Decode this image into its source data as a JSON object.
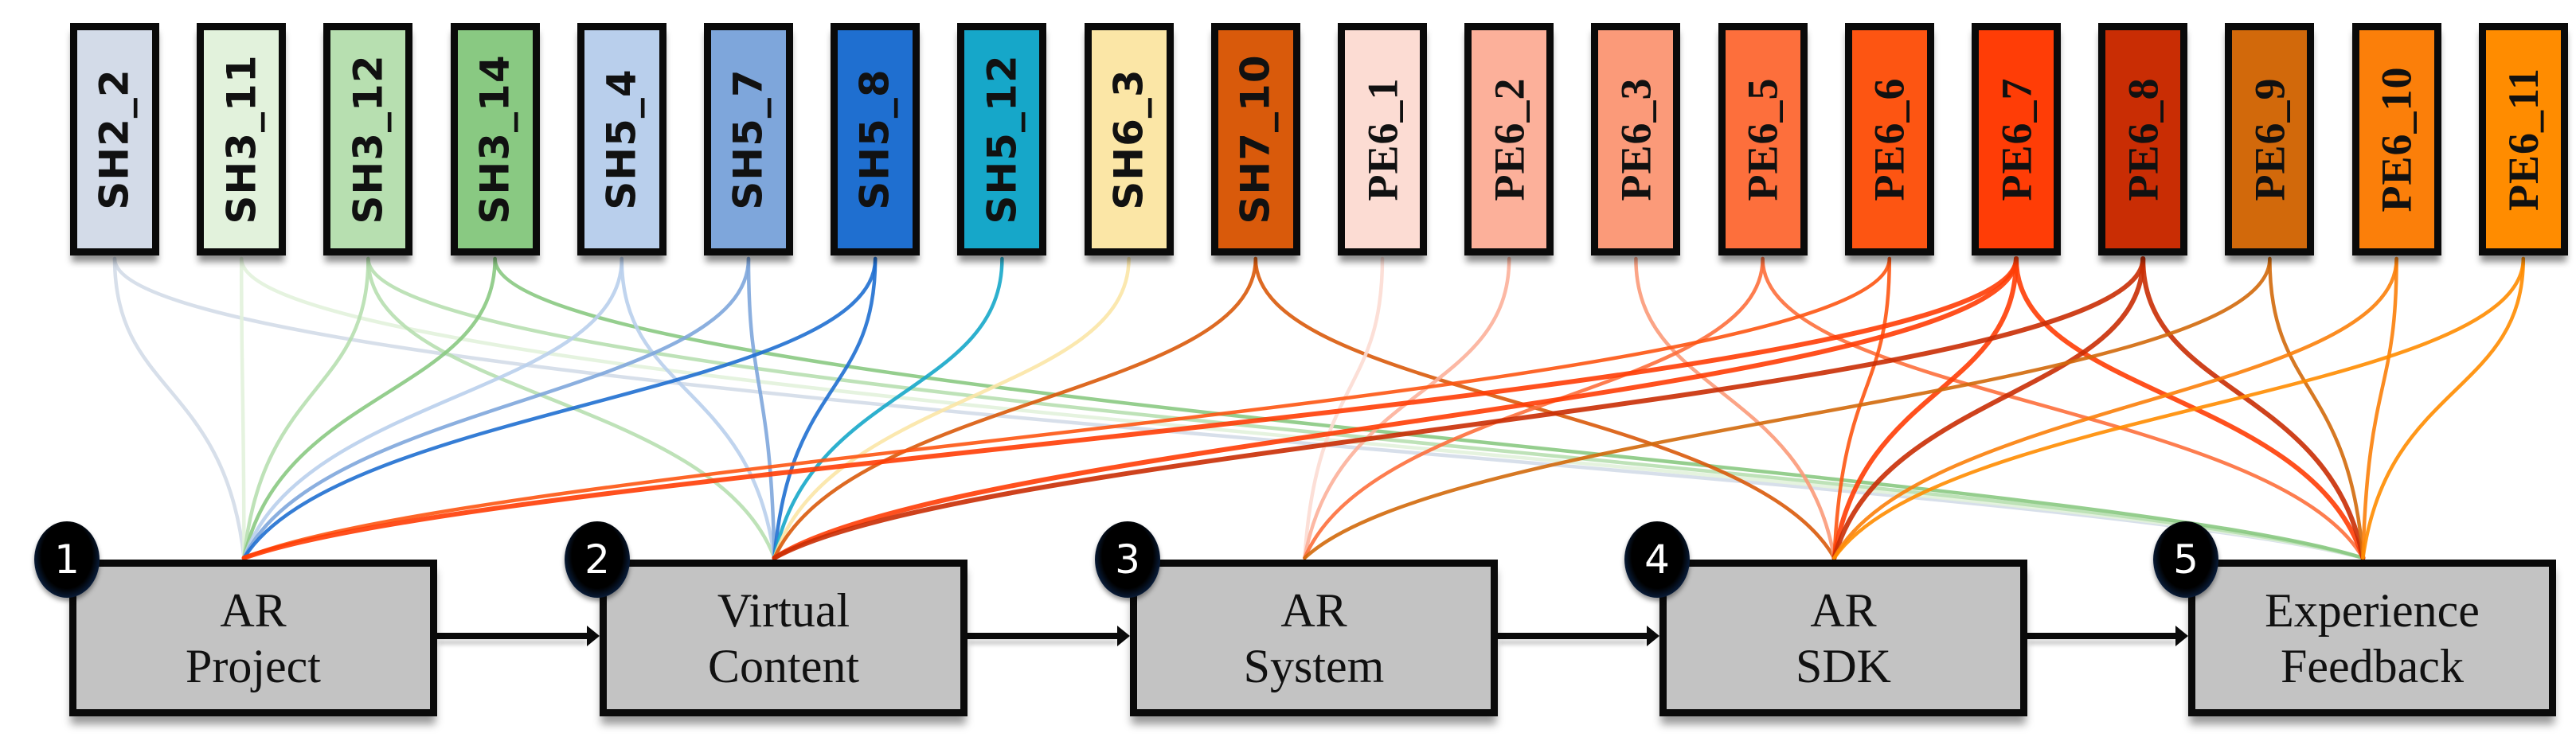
{
  "diagram": {
    "type": "bipartite-flow",
    "tags": [
      {
        "id": "SH2_2",
        "label": "SH2_2",
        "color": "#d3dbe8",
        "group": "SH"
      },
      {
        "id": "SH3_11",
        "label": "SH3_11",
        "color": "#e2f2dc",
        "group": "SH"
      },
      {
        "id": "SH3_12",
        "label": "SH3_12",
        "color": "#b7dfb0",
        "group": "SH"
      },
      {
        "id": "SH3_14",
        "label": "SH3_14",
        "color": "#89c982",
        "group": "SH"
      },
      {
        "id": "SH5_4",
        "label": "SH5_4",
        "color": "#b9cfec",
        "group": "SH"
      },
      {
        "id": "SH5_7",
        "label": "SH5_7",
        "color": "#7ea6db",
        "group": "SH"
      },
      {
        "id": "SH5_8",
        "label": "SH5_8",
        "color": "#1f6fd0",
        "group": "SH"
      },
      {
        "id": "SH5_12",
        "label": "SH5_12",
        "color": "#16a7c9",
        "group": "SH"
      },
      {
        "id": "SH6_3",
        "label": "SH6_3",
        "color": "#fbe6a6",
        "group": "SH"
      },
      {
        "id": "SH7_10",
        "label": "SH7_10",
        "color": "#d95a0b",
        "group": "SH"
      },
      {
        "id": "PE6_1",
        "label": "PE6_1",
        "color": "#fcdcd3",
        "group": "PE"
      },
      {
        "id": "PE6_2",
        "label": "PE6_2",
        "color": "#fcb09a",
        "group": "PE"
      },
      {
        "id": "PE6_3",
        "label": "PE6_3",
        "color": "#fb9a79",
        "group": "PE"
      },
      {
        "id": "PE6_5",
        "label": "PE6_5",
        "color": "#fd6f3c",
        "group": "PE"
      },
      {
        "id": "PE6_6",
        "label": "PE6_6",
        "color": "#fd5512",
        "group": "PE"
      },
      {
        "id": "PE6_7",
        "label": "PE6_7",
        "color": "#ff3d06",
        "group": "PE"
      },
      {
        "id": "PE6_8",
        "label": "PE6_8",
        "color": "#c92d04",
        "group": "PE"
      },
      {
        "id": "PE6_9",
        "label": "PE6_9",
        "color": "#d2690b",
        "group": "PE"
      },
      {
        "id": "PE6_10",
        "label": "PE6_10",
        "color": "#fb7f0a",
        "group": "PE"
      },
      {
        "id": "PE6_11",
        "label": "PE6_11",
        "color": "#ff8c00",
        "group": "PE"
      }
    ],
    "steps": [
      {
        "number": "1",
        "lines": [
          "AR",
          "Project"
        ]
      },
      {
        "number": "2",
        "lines": [
          "Virtual",
          "Content"
        ]
      },
      {
        "number": "3",
        "lines": [
          "AR",
          "System"
        ]
      },
      {
        "number": "4",
        "lines": [
          "AR",
          "SDK"
        ]
      },
      {
        "number": "5",
        "lines": [
          "Experience",
          "Feedback"
        ]
      }
    ],
    "links": [
      [
        "SH2_2",
        1
      ],
      [
        "SH2_2",
        5
      ],
      [
        "SH3_11",
        1
      ],
      [
        "SH3_11",
        5
      ],
      [
        "SH3_12",
        1
      ],
      [
        "SH3_12",
        2
      ],
      [
        "SH3_12",
        5
      ],
      [
        "SH3_14",
        1
      ],
      [
        "SH3_14",
        5
      ],
      [
        "SH5_4",
        1
      ],
      [
        "SH5_4",
        2
      ],
      [
        "SH5_7",
        1
      ],
      [
        "SH5_7",
        2
      ],
      [
        "SH5_8",
        1
      ],
      [
        "SH5_8",
        2
      ],
      [
        "SH5_12",
        2
      ],
      [
        "SH6_3",
        2
      ],
      [
        "SH7_10",
        2
      ],
      [
        "SH7_10",
        4
      ],
      [
        "PE6_1",
        3
      ],
      [
        "PE6_2",
        3
      ],
      [
        "PE6_3",
        4
      ],
      [
        "PE6_5",
        3
      ],
      [
        "PE6_5",
        5
      ],
      [
        "PE6_6",
        4
      ],
      [
        "PE6_6",
        1
      ],
      [
        "PE6_7",
        1
      ],
      [
        "PE6_7",
        2
      ],
      [
        "PE6_7",
        4
      ],
      [
        "PE6_7",
        5
      ],
      [
        "PE6_8",
        2
      ],
      [
        "PE6_8",
        4
      ],
      [
        "PE6_8",
        5
      ],
      [
        "PE6_9",
        3
      ],
      [
        "PE6_9",
        5
      ],
      [
        "PE6_10",
        4
      ],
      [
        "PE6_10",
        5
      ],
      [
        "PE6_11",
        4
      ],
      [
        "PE6_11",
        5
      ]
    ]
  }
}
